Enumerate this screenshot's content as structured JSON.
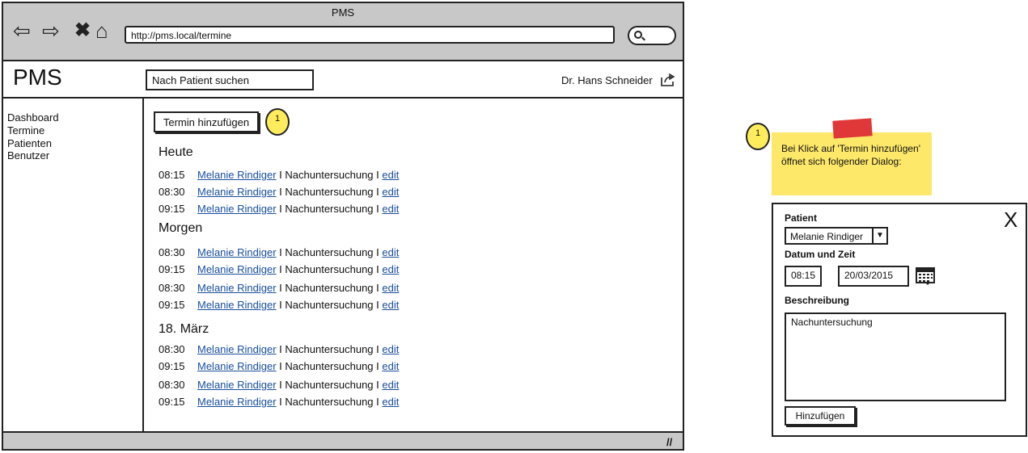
{
  "browser": {
    "title": "PMS",
    "url": "http://pms.local/termine"
  },
  "header": {
    "logo": "PMS",
    "search_placeholder": "Nach Patient suchen",
    "user": "Dr. Hans Schneider"
  },
  "sidebar": {
    "items": [
      {
        "label": "Dashboard"
      },
      {
        "label": "Termine"
      },
      {
        "label": "Patienten"
      },
      {
        "label": "Benutzer"
      }
    ]
  },
  "content": {
    "add_button": "Termin hinzufügen",
    "badge": "1",
    "separator": " I ",
    "sections": [
      {
        "heading": "Heute",
        "rows": [
          {
            "time": "08:15",
            "patient": "Melanie Rindiger",
            "type": "Nachuntersuchung",
            "action": "edit"
          },
          {
            "time": "08:30",
            "patient": "Melanie Rindiger",
            "type": "Nachuntersuchung",
            "action": "edit"
          },
          {
            "time": "09:15",
            "patient": "Melanie Rindiger",
            "type": "Nachuntersuchung",
            "action": "edit"
          }
        ]
      },
      {
        "heading": "Morgen",
        "rows": [
          {
            "time": "08:30",
            "patient": "Melanie Rindiger",
            "type": "Nachuntersuchung",
            "action": "edit"
          },
          {
            "time": "09:15",
            "patient": "Melanie Rindiger",
            "type": "Nachuntersuchung",
            "action": "edit"
          },
          {
            "time": "08:30",
            "patient": "Melanie Rindiger",
            "type": "Nachuntersuchung",
            "action": "edit"
          },
          {
            "time": "09:15",
            "patient": "Melanie Rindiger",
            "type": "Nachuntersuchung",
            "action": "edit"
          }
        ]
      },
      {
        "heading": "18. März",
        "rows": [
          {
            "time": "08:30",
            "patient": "Melanie Rindiger",
            "type": "Nachuntersuchung",
            "action": "edit"
          },
          {
            "time": "09:15",
            "patient": "Melanie Rindiger",
            "type": "Nachuntersuchung",
            "action": "edit"
          },
          {
            "time": "08:30",
            "patient": "Melanie Rindiger",
            "type": "Nachuntersuchung",
            "action": "edit"
          },
          {
            "time": "09:15",
            "patient": "Melanie Rindiger",
            "type": "Nachuntersuchung",
            "action": "edit"
          }
        ]
      }
    ]
  },
  "note": {
    "badge": "1",
    "text": "Bei Klick auf 'Termin hinzufügen' öffnet sich folgender Dialog:"
  },
  "dialog": {
    "close": "X",
    "patient_label": "Patient",
    "patient_value": "Melanie Rindiger",
    "datetime_label": "Datum und Zeit",
    "time_value": "08:15",
    "date_value": "20/03/2015",
    "description_label": "Beschreibung",
    "description_value": "Nachuntersuchung",
    "submit_label": "Hinzufügen"
  },
  "colors": {
    "chrome": "#c8c8c8",
    "sticky": "#fde86a",
    "badge": "#ffec5c",
    "tape": "#e03838",
    "link": "#1a4e9c"
  }
}
